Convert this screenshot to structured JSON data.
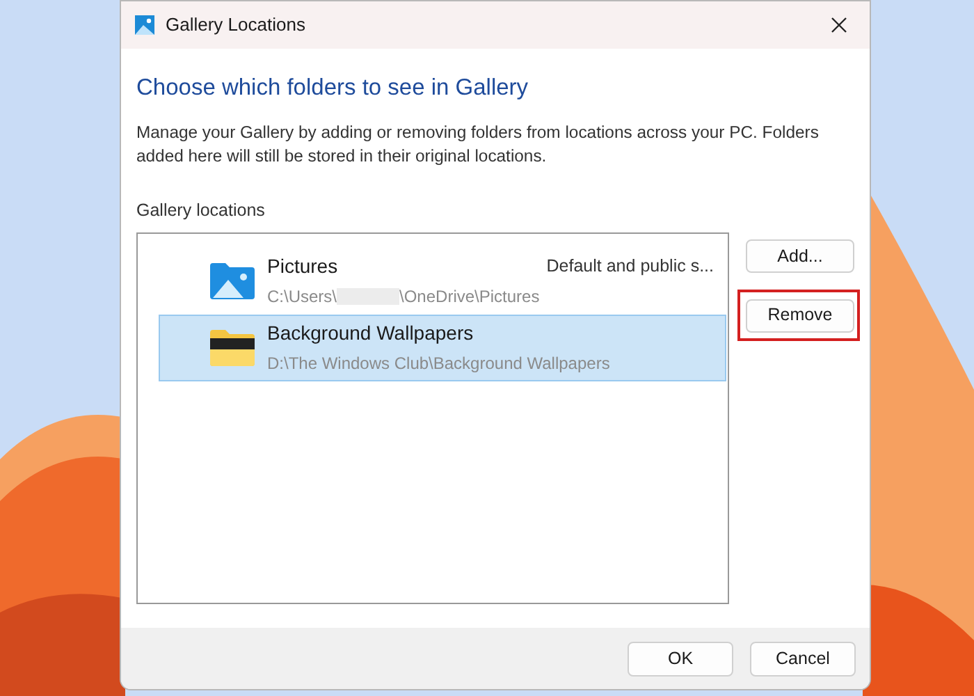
{
  "window": {
    "title": "Gallery Locations"
  },
  "heading": "Choose which folders to see in Gallery",
  "description": "Manage your Gallery by adding or removing folders from locations across your PC. Folders added here will still be stored in their original locations.",
  "list_label": "Gallery locations",
  "locations": [
    {
      "name": "Pictures",
      "kind": "pictures",
      "path_parts": [
        "C:\\Users\\",
        "\\OneDrive\\Pictures"
      ],
      "note": "Default and public s...",
      "selected": false
    },
    {
      "name": "Background Wallpapers",
      "kind": "folder",
      "path_parts": [
        "D:\\The Windows Club\\Background Wallpapers"
      ],
      "selected": true
    }
  ],
  "side_buttons": [
    {
      "label": "Add...",
      "highlighted": false
    },
    {
      "label": "Remove",
      "highlighted": true
    }
  ],
  "footer_buttons": [
    "OK",
    "Cancel"
  ]
}
